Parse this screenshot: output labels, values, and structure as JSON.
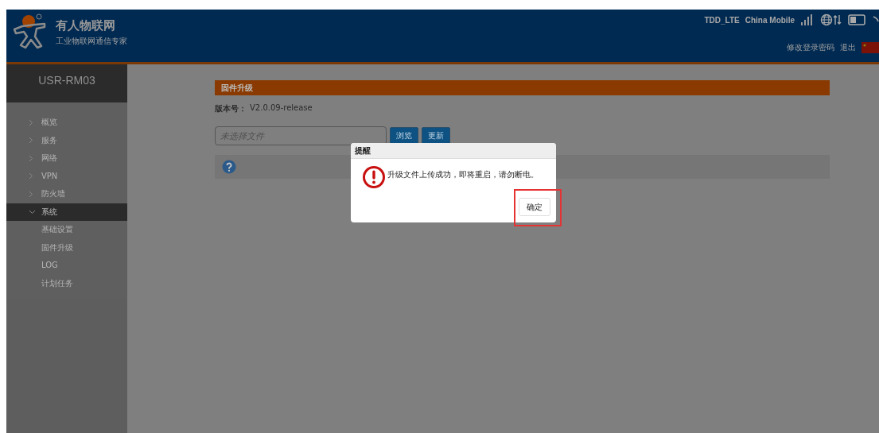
{
  "header": {
    "brand": "有人物联网",
    "tagline": "工业物联网通信专家",
    "network_type": "TDD_LTE",
    "carrier": "China Mobile",
    "links": [
      "修改登录密码",
      "退出"
    ]
  },
  "sidebar": {
    "device": "USR-RM03",
    "items": [
      {
        "label": "概览",
        "expanded": false
      },
      {
        "label": "服务",
        "expanded": false
      },
      {
        "label": "网络",
        "expanded": false
      },
      {
        "label": "VPN",
        "expanded": false
      },
      {
        "label": "防火墙",
        "expanded": false
      },
      {
        "label": "系统",
        "expanded": true,
        "children": [
          {
            "label": "基础设置"
          },
          {
            "label": "固件升级"
          },
          {
            "label": "LOG"
          },
          {
            "label": "计划任务"
          }
        ]
      }
    ]
  },
  "section": {
    "title": "固件升级",
    "version_label": "版本号：",
    "version": "V2.0.09-release",
    "file_placeholder": "未选择文件",
    "buttons": [
      "浏览",
      "更新"
    ]
  },
  "dialog": {
    "title": "提醒",
    "message": "升级文件上传成功，即将重启，请勿断电。",
    "button": "确定"
  }
}
